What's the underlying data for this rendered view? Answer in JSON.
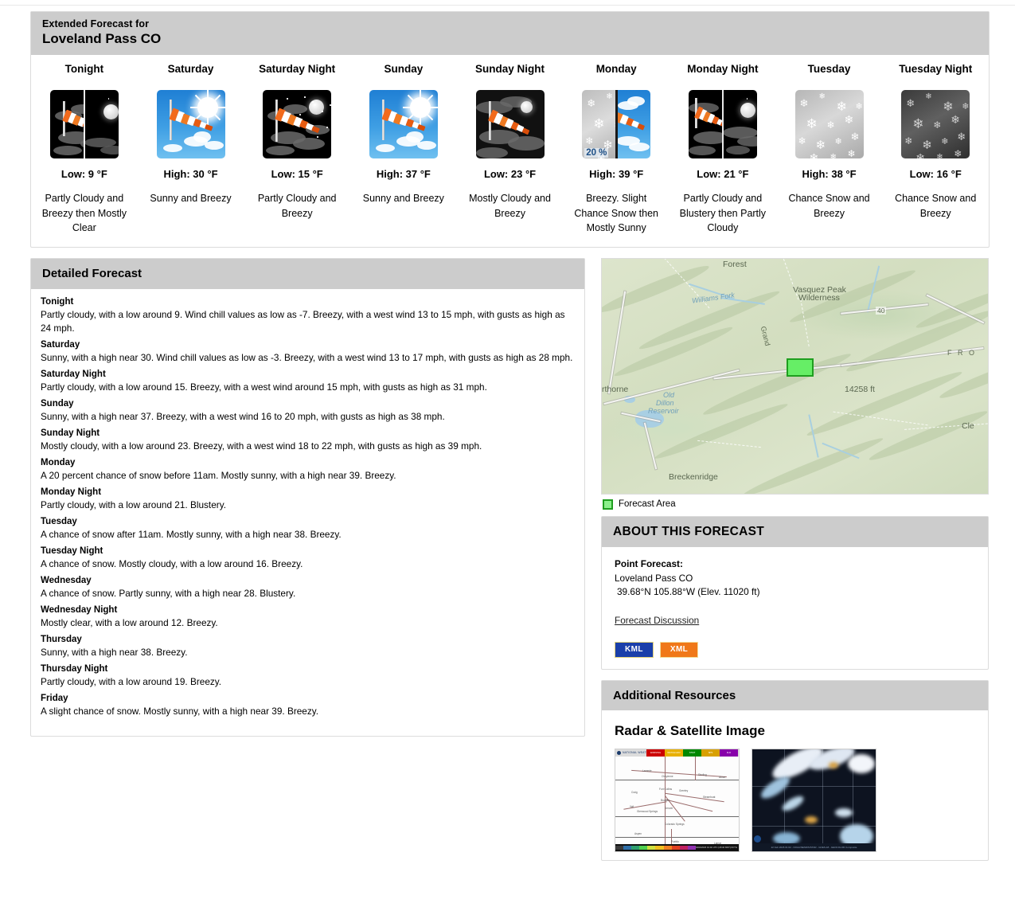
{
  "extended": {
    "label": "Extended Forecast for",
    "location": "Loveland Pass CO",
    "periods": [
      {
        "day": "Tonight",
        "icon": "wind-few-clouds-night",
        "temp": "Low: 9 °F",
        "desc": "Partly Cloudy and Breezy then Mostly Clear"
      },
      {
        "day": "Saturday",
        "icon": "wind-sunny-day",
        "temp": "High: 30 °F",
        "desc": "Sunny and Breezy"
      },
      {
        "day": "Saturday Night",
        "icon": "wind-partly-cloudy-night",
        "temp": "Low: 15 °F",
        "desc": "Partly Cloudy and Breezy"
      },
      {
        "day": "Sunday",
        "icon": "wind-sunny-day",
        "temp": "High: 37 °F",
        "desc": "Sunny and Breezy"
      },
      {
        "day": "Sunday Night",
        "icon": "wind-mostly-cloudy-night",
        "temp": "Low: 23 °F",
        "desc": "Mostly Cloudy and Breezy"
      },
      {
        "day": "Monday",
        "icon": "snow-then-wind-sunny-day",
        "temp": "High: 39 °F",
        "desc": "Breezy. Slight Chance Snow then Mostly Sunny",
        "pop": "20 %"
      },
      {
        "day": "Monday Night",
        "icon": "wind-night-then-partly-cloudy-night",
        "temp": "Low: 21 °F",
        "desc": "Partly Cloudy and Blustery then Partly Cloudy"
      },
      {
        "day": "Tuesday",
        "icon": "chance-snow-day",
        "temp": "High: 38 °F",
        "desc": "Chance Snow and Breezy"
      },
      {
        "day": "Tuesday Night",
        "icon": "chance-snow-night",
        "temp": "Low: 16 °F",
        "desc": "Chance Snow and Breezy"
      }
    ]
  },
  "detailed": {
    "title": "Detailed Forecast",
    "items": [
      {
        "day": "Tonight",
        "text": "Partly cloudy, with a low around 9. Wind chill values as low as -7. Breezy, with a west wind 13 to 15 mph, with gusts as high as 24 mph."
      },
      {
        "day": "Saturday",
        "text": "Sunny, with a high near 30. Wind chill values as low as -3. Breezy, with a west wind 13 to 17 mph, with gusts as high as 28 mph."
      },
      {
        "day": "Saturday Night",
        "text": "Partly cloudy, with a low around 15. Breezy, with a west wind around 15 mph, with gusts as high as 31 mph."
      },
      {
        "day": "Sunday",
        "text": "Sunny, with a high near 37. Breezy, with a west wind 16 to 20 mph, with gusts as high as 38 mph."
      },
      {
        "day": "Sunday Night",
        "text": "Mostly cloudy, with a low around 23. Breezy, with a west wind 18 to 22 mph, with gusts as high as 39 mph."
      },
      {
        "day": "Monday",
        "text": "A 20 percent chance of snow before 11am. Mostly sunny, with a high near 39. Breezy."
      },
      {
        "day": "Monday Night",
        "text": "Partly cloudy, with a low around 21. Blustery."
      },
      {
        "day": "Tuesday",
        "text": "A chance of snow after 11am. Mostly sunny, with a high near 38. Breezy."
      },
      {
        "day": "Tuesday Night",
        "text": "A chance of snow. Mostly cloudy, with a low around 16. Breezy."
      },
      {
        "day": "Wednesday",
        "text": "A chance of snow. Partly sunny, with a high near 28. Blustery."
      },
      {
        "day": "Wednesday Night",
        "text": "Mostly clear, with a low around 12. Breezy."
      },
      {
        "day": "Thursday",
        "text": "Sunny, with a high near 38. Breezy."
      },
      {
        "day": "Thursday Night",
        "text": "Partly cloudy, with a low around 19. Breezy."
      },
      {
        "day": "Friday",
        "text": "A slight chance of snow. Mostly sunny, with a high near 39. Breezy."
      }
    ]
  },
  "map": {
    "legend_label": "Forecast Area",
    "labels": {
      "forest": "Forest",
      "vasquez": "Vasquez Peak",
      "wilderness": "Wilderness",
      "williams_fork": "Williams Fork",
      "grand": "Grand",
      "hwy40": "40",
      "front": "F R O",
      "peak_elev": "14258 ft",
      "silverthorne": "rthorne",
      "old_dillon": "Old",
      "dillon": "Dillon",
      "reservoir": "Reservoir",
      "breckenridge": "Breckenridge",
      "clear": "Cle"
    }
  },
  "about": {
    "title": "ABOUT THIS FORECAST",
    "point_forecast_label": "Point Forecast:",
    "point_name": "Loveland Pass CO",
    "coordinates": "39.68°N 105.88°W (Elev. 11020 ft)",
    "discussion_link": "Forecast Discussion",
    "kml_label": "KML",
    "xml_label": "XML"
  },
  "additional": {
    "title": "Additional Resources",
    "radar_heading": "Radar & Satellite Image",
    "radar_thumb": {
      "agency": "NATIONAL WEATHER SERVICE",
      "legend": [
        "WARNING",
        "WATCH/ADV",
        "STMT",
        "SPS",
        "FLD"
      ],
      "cities": [
        "Laramie",
        "Cheyenne",
        "Sterling",
        "Akron",
        "Fort Collins",
        "Greeley",
        "Craig",
        "Steamboat",
        "Boulder",
        "Denver",
        "Vail",
        "Glenwood Springs",
        "Colorado Springs",
        "Aspen",
        "Pueblo",
        "Lamar"
      ],
      "timestamp": "0202/2026 01:40 UTC (18:40 MST) KFTG"
    },
    "satellite_thumb": {
      "caption": "22 Feb 2026 01:02 - NOAA/NESDIS/STAR - GOES-18 - GEOCOLOR Composite"
    }
  },
  "colors": {
    "header_gray": "#cccccc",
    "panel_border": "#dcdcdc",
    "forecast_area_green": "#66ee66",
    "kml_blue": "#1a3faa",
    "xml_orange": "#f07818",
    "sky_blue": "#3f9fe4",
    "sock_orange": "#e8601c"
  }
}
